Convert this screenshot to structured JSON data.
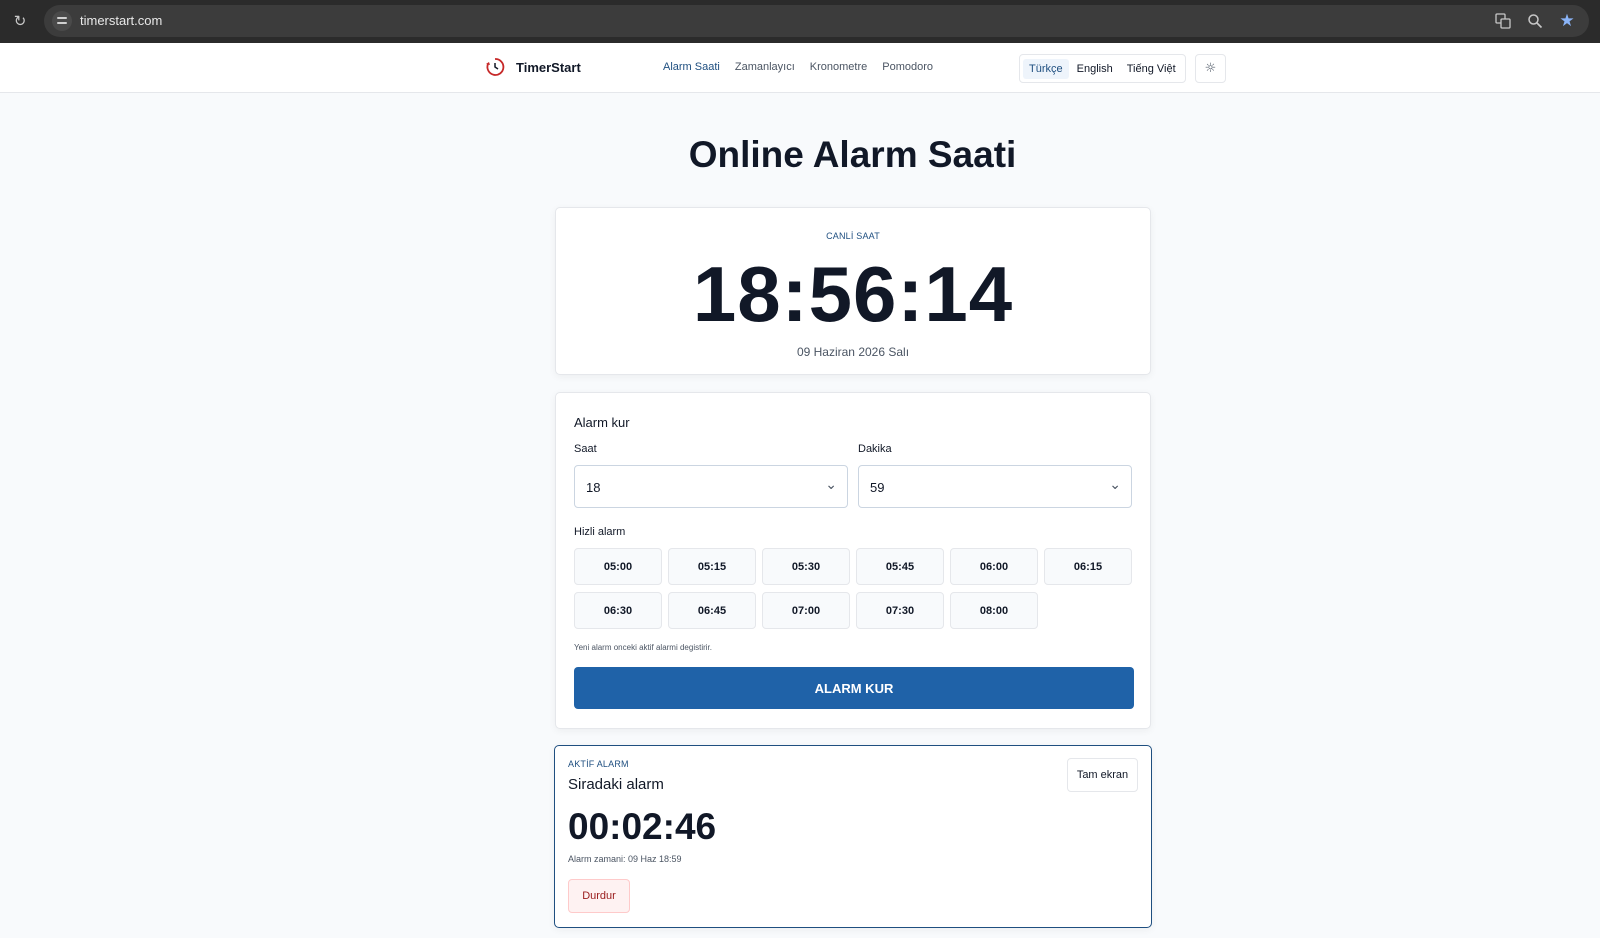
{
  "browser": {
    "url": "timerstart.com",
    "icons": [
      "reload-icon",
      "site-info-icon",
      "translate-icon",
      "zoom-icon",
      "bookmark-star-icon"
    ]
  },
  "header": {
    "brand": "TimerStart",
    "nav": [
      "Alarm Saati",
      "Zamanlayıcı",
      "Kronometre",
      "Pomodoro"
    ],
    "active_nav": "Alarm Saati",
    "languages": [
      "Türkçe",
      "English",
      "Tiếng Việt"
    ],
    "active_language": "Türkçe",
    "theme_icon": "sun-icon"
  },
  "page": {
    "title": "Online Alarm Saati"
  },
  "clock": {
    "eyebrow": "CANLİ SAAT",
    "time": "18:56:14",
    "date": "09 Haziran 2026 Salı"
  },
  "alarm_form": {
    "title": "Alarm kur",
    "hour_label": "Saat",
    "hour_value": "18",
    "minute_label": "Dakika",
    "minute_value": "59",
    "quick_label": "Hizli alarm",
    "quick_times": [
      "05:00",
      "05:15",
      "05:30",
      "05:45",
      "06:00",
      "06:15",
      "06:30",
      "06:45",
      "07:00",
      "07:30",
      "08:00"
    ],
    "hint": "Yeni alarm onceki aktif alarmi degistirir.",
    "submit_label": "ALARM KUR"
  },
  "active_alarm": {
    "eyebrow": "AKTİF ALARM",
    "title": "Siradaki alarm",
    "countdown": "00:02:46",
    "alarm_time": "Alarm zamani: 09 Haz 18:59",
    "stop_label": "Durdur",
    "fullscreen_label": "Tam ekran"
  },
  "colors": {
    "accent": "#1f62a8",
    "accent_dark": "#1f4f80",
    "danger_bg": "#fef2f2",
    "danger_text": "#991b1b"
  }
}
